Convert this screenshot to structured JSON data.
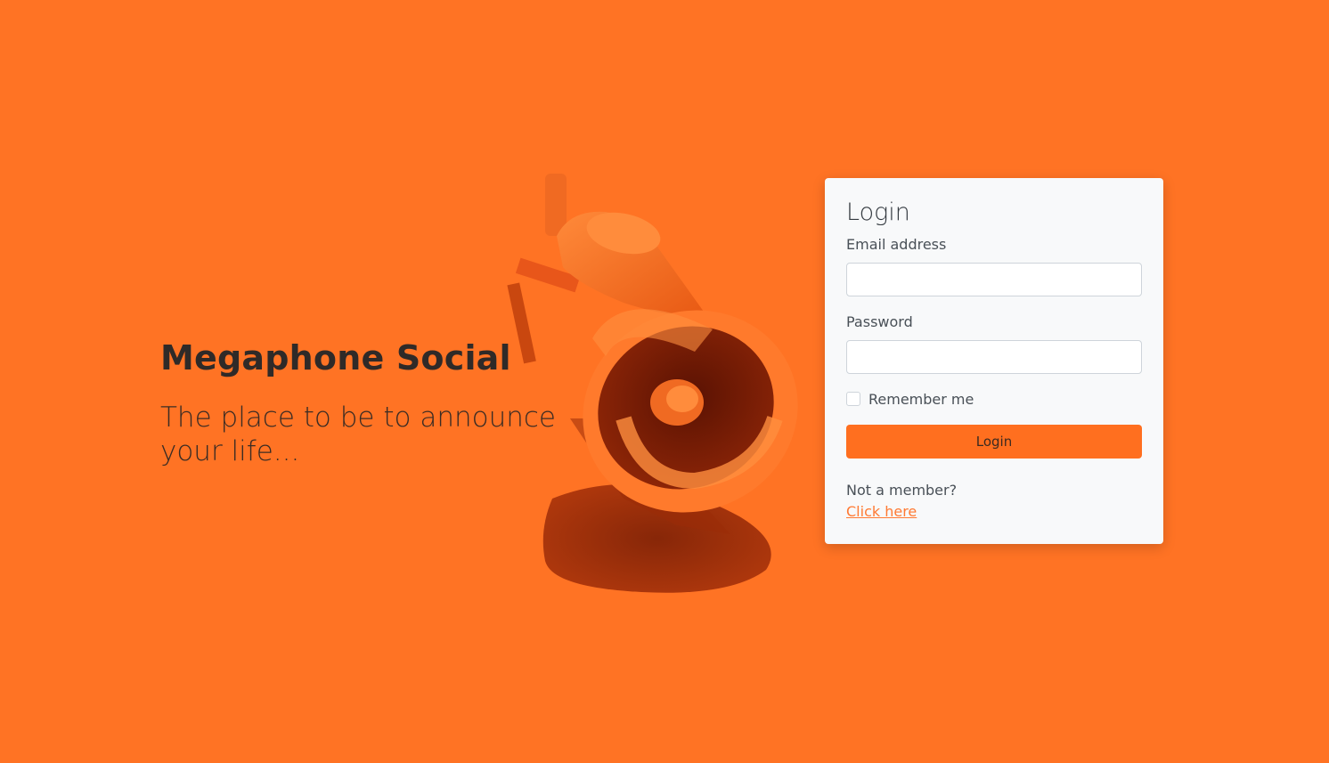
{
  "brand": {
    "title": "Megaphone Social",
    "tagline": "The place to be to announce your life..."
  },
  "login_form": {
    "title": "Login",
    "email_label": "Email address",
    "email_value": "",
    "password_label": "Password",
    "password_value": "",
    "remember_label": "Remember me",
    "remember_checked": false,
    "submit_label": "Login",
    "signup_prompt": "Not a member?",
    "signup_link": "Click here"
  },
  "colors": {
    "background": "#ff7324",
    "accent": "#ff6f1f",
    "card": "#f8f9fa",
    "link": "#ff7a33"
  },
  "icons": {
    "hero": "megaphone-illustration"
  }
}
